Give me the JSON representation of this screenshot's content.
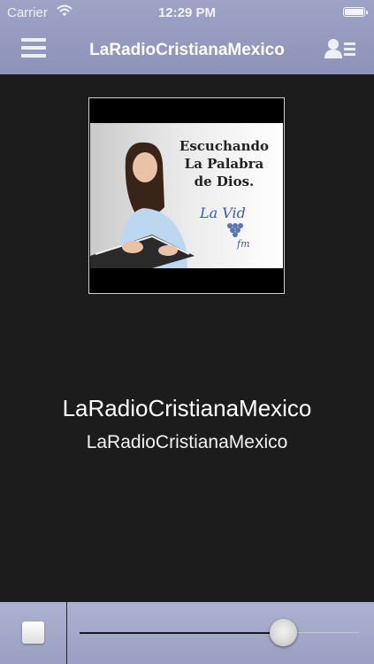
{
  "status_bar": {
    "carrier": "Carrier",
    "time": "12:29 PM",
    "wifi_icon": "wifi-icon",
    "battery_icon": "battery-icon"
  },
  "nav": {
    "title": "LaRadioCristianaMexico",
    "menu_icon": "hamburger-menu-icon",
    "contact_icon": "contact-card-icon"
  },
  "artwork": {
    "caption_line1": "Escuchando",
    "caption_line2": "La Palabra",
    "caption_line3": "de Dios.",
    "logo_text": "La Vid",
    "logo_sub": "fm"
  },
  "now_playing": {
    "station": "LaRadioCristianaMexico",
    "subtitle": "LaRadioCristianaMexico"
  },
  "player": {
    "stop_icon": "stop-icon",
    "volume_level": 0.73
  },
  "colors": {
    "bar": "#9a9fc3",
    "background": "#1c1c1c",
    "text": "#ffffff"
  }
}
